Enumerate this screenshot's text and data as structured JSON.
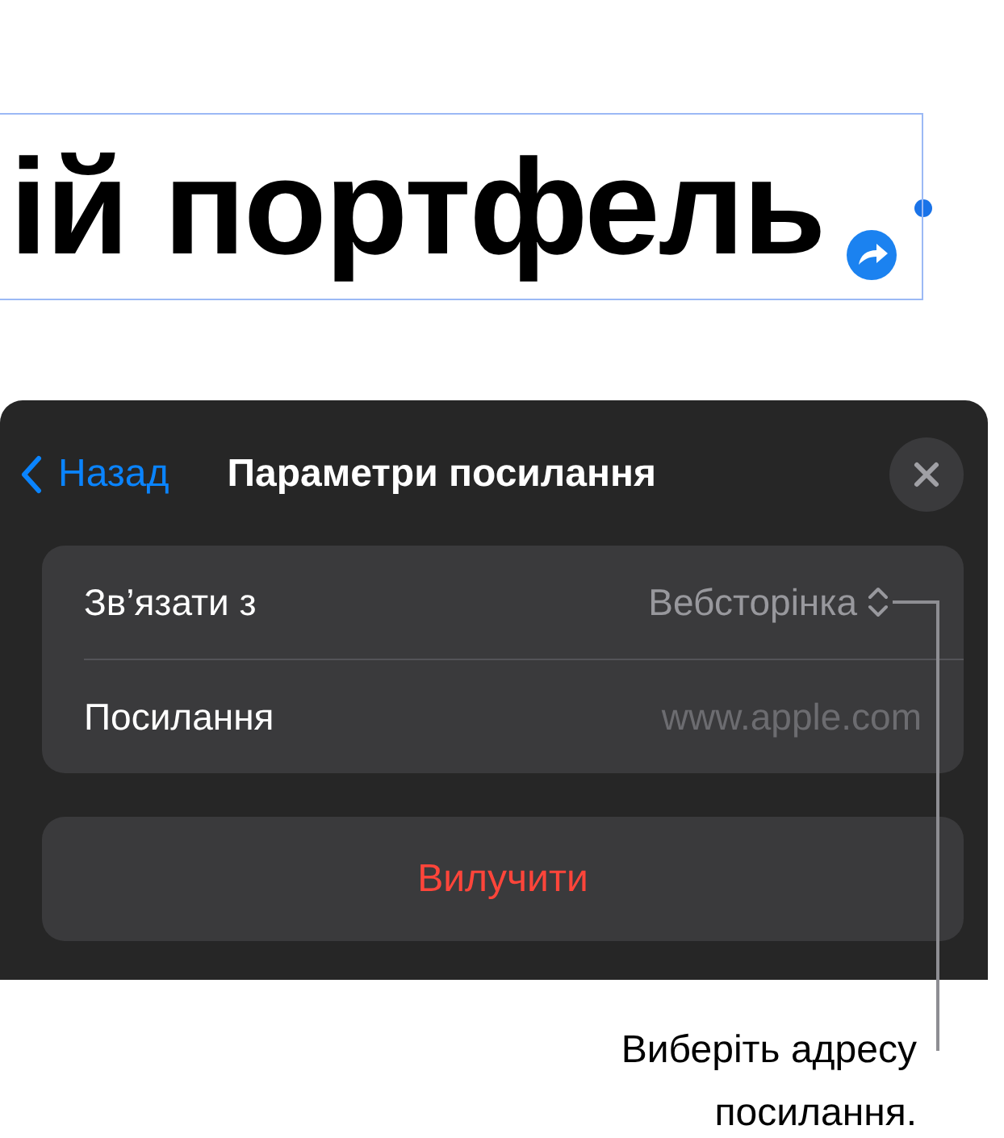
{
  "document": {
    "title": "ій портфель"
  },
  "panel": {
    "back": "Назад",
    "title": "Параметри посилання",
    "rows": [
      {
        "kind": "picker",
        "label": "Зв’язати з",
        "value": "Вебсторінка"
      },
      {
        "kind": "field",
        "label": "Посилання",
        "placeholder": "www.apple.com"
      }
    ],
    "action": "Вилучити"
  },
  "callout": "Виберіть адресу посилання."
}
